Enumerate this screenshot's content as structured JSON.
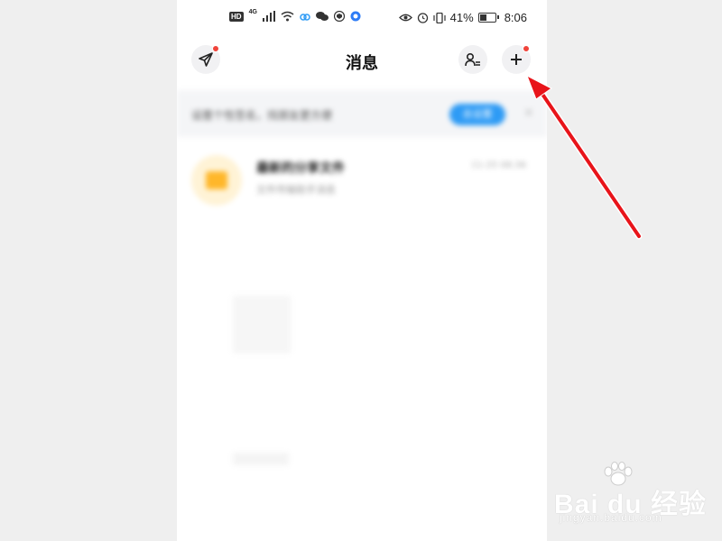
{
  "status_bar": {
    "hd": "HD",
    "network": "4G",
    "battery_percent": "41%",
    "time": "8:06"
  },
  "header": {
    "title": "消息",
    "send_icon": "paper-plane-icon",
    "contacts_icon": "person-list-icon",
    "add_icon": "plus-icon",
    "notification_dot_color": "#f0443b"
  },
  "banner": {
    "text": "设置个性签名，找朋友更方便",
    "button_label": "去设置",
    "button_color": "#2e9bf5",
    "close": "×"
  },
  "messages": [
    {
      "title": "最新的分享文件",
      "subtitle": "文件传输助手消息",
      "time": "11-25 08:36",
      "icon": "folder-icon"
    }
  ],
  "annotation": {
    "arrow_color": "#e8141a",
    "arrow_points_to": "plus-icon"
  },
  "watermark": {
    "main": "Bai du 经验",
    "sub": "jingyan.baidu.com"
  }
}
